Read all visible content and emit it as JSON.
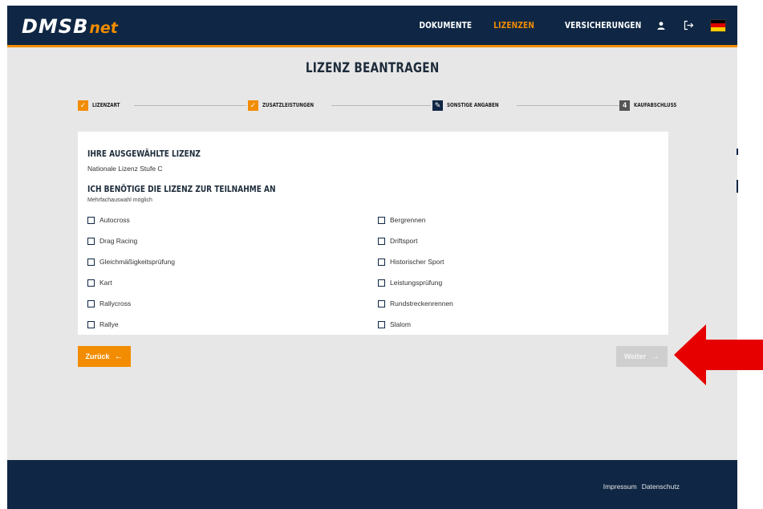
{
  "header": {
    "logo_main": "DMSB",
    "logo_sub": "net",
    "nav": [
      "DOKUMENTE",
      "LIZENZEN",
      "VERSICHERUNGEN"
    ],
    "active_nav": "LIZENZEN",
    "icons": [
      "user-icon",
      "logout-icon",
      "german-flag-icon"
    ]
  },
  "page_title": "LIZENZ BEANTRAGEN",
  "stepper": {
    "steps": [
      {
        "label": "LIZENZART",
        "state": "done",
        "marker": "✓"
      },
      {
        "label": "ZUSATZLEISTUNGEN",
        "state": "done",
        "marker": "✓"
      },
      {
        "label": "SONSTIGE ANGABEN",
        "state": "current",
        "marker": "✎"
      },
      {
        "label": "KAUFABSCHLUSS",
        "state": "pending",
        "marker": "4"
      }
    ]
  },
  "selected_license": {
    "heading": "IHRE AUSGEWÄHLTE LIZENZ",
    "value": "Nationale Lizenz Stufe C"
  },
  "participation": {
    "heading": "ICH BENÖTIGE DIE LIZENZ ZUR TEILNAHME AN",
    "hint": "Mehrfachauswahl möglich",
    "options_left": [
      "Autocross",
      "Drag Racing",
      "Gleichmäßigkeitsprüfung",
      "Kart",
      "Rallycross",
      "Rallye"
    ],
    "options_right": [
      "Bergrennen",
      "Driftsport",
      "Historischer Sport",
      "Leistungsprüfung",
      "Rundstreckenrennen",
      "Slalom"
    ]
  },
  "buttons": {
    "back_label": "Zurück",
    "next_label": "Weiter"
  },
  "footer": {
    "links": [
      "Impressum",
      "Datenschutz"
    ]
  },
  "colors": {
    "navy": "#0f2744",
    "orange": "#f28c00",
    "background": "#e7e7e7",
    "annotation_red": "#e60000"
  }
}
